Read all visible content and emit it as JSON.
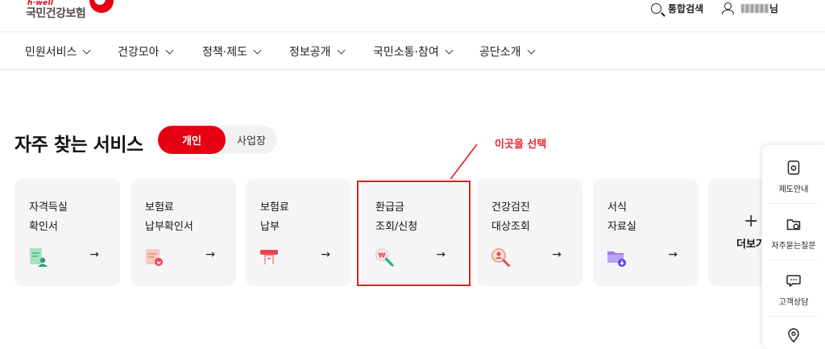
{
  "header": {
    "logo_sub": "h·well",
    "logo_main": "국민건강보험",
    "search_label": "통합검색",
    "user_name_suffix": "님"
  },
  "nav": {
    "items": [
      "민원서비스",
      "건강모아",
      "정책·제도",
      "정보공개",
      "국민소통·참여",
      "공단소개"
    ]
  },
  "section": {
    "title": "자주 찾는 서비스",
    "tabs": [
      "개인",
      "사업장"
    ],
    "active_tab": "개인"
  },
  "annotation": {
    "text": "이곳을 선택",
    "color": "#e8262f"
  },
  "cards": [
    {
      "label": "자격득실\n확인서",
      "arrow": "→",
      "icon": "certificate-person-icon"
    },
    {
      "label": "보험료\n납부확인서",
      "arrow": "→",
      "icon": "payment-certificate-icon"
    },
    {
      "label": "보험료\n납부",
      "arrow": "→",
      "icon": "card-payment-icon"
    },
    {
      "label": "환급금\n조회/신청",
      "arrow": "→",
      "icon": "refund-search-icon"
    },
    {
      "label": "건강검진\n대상조회",
      "arrow": "→",
      "icon": "person-search-icon"
    },
    {
      "label": "서식\n자료실",
      "arrow": "→",
      "icon": "folder-download-icon"
    }
  ],
  "more": {
    "plus": "+",
    "label": "더보기"
  },
  "quick_menu": [
    {
      "label": "제도안내",
      "icon": "document-icon"
    },
    {
      "label": "자주묻는질문",
      "icon": "faq-folder-icon"
    },
    {
      "label": "고객상담",
      "icon": "chat-bubble-icon"
    },
    {
      "icon": "location-pin-icon"
    }
  ],
  "colors": {
    "brand_red": "#e60012",
    "card_bg": "#f5f5f7",
    "highlight_border": "#e02020"
  }
}
